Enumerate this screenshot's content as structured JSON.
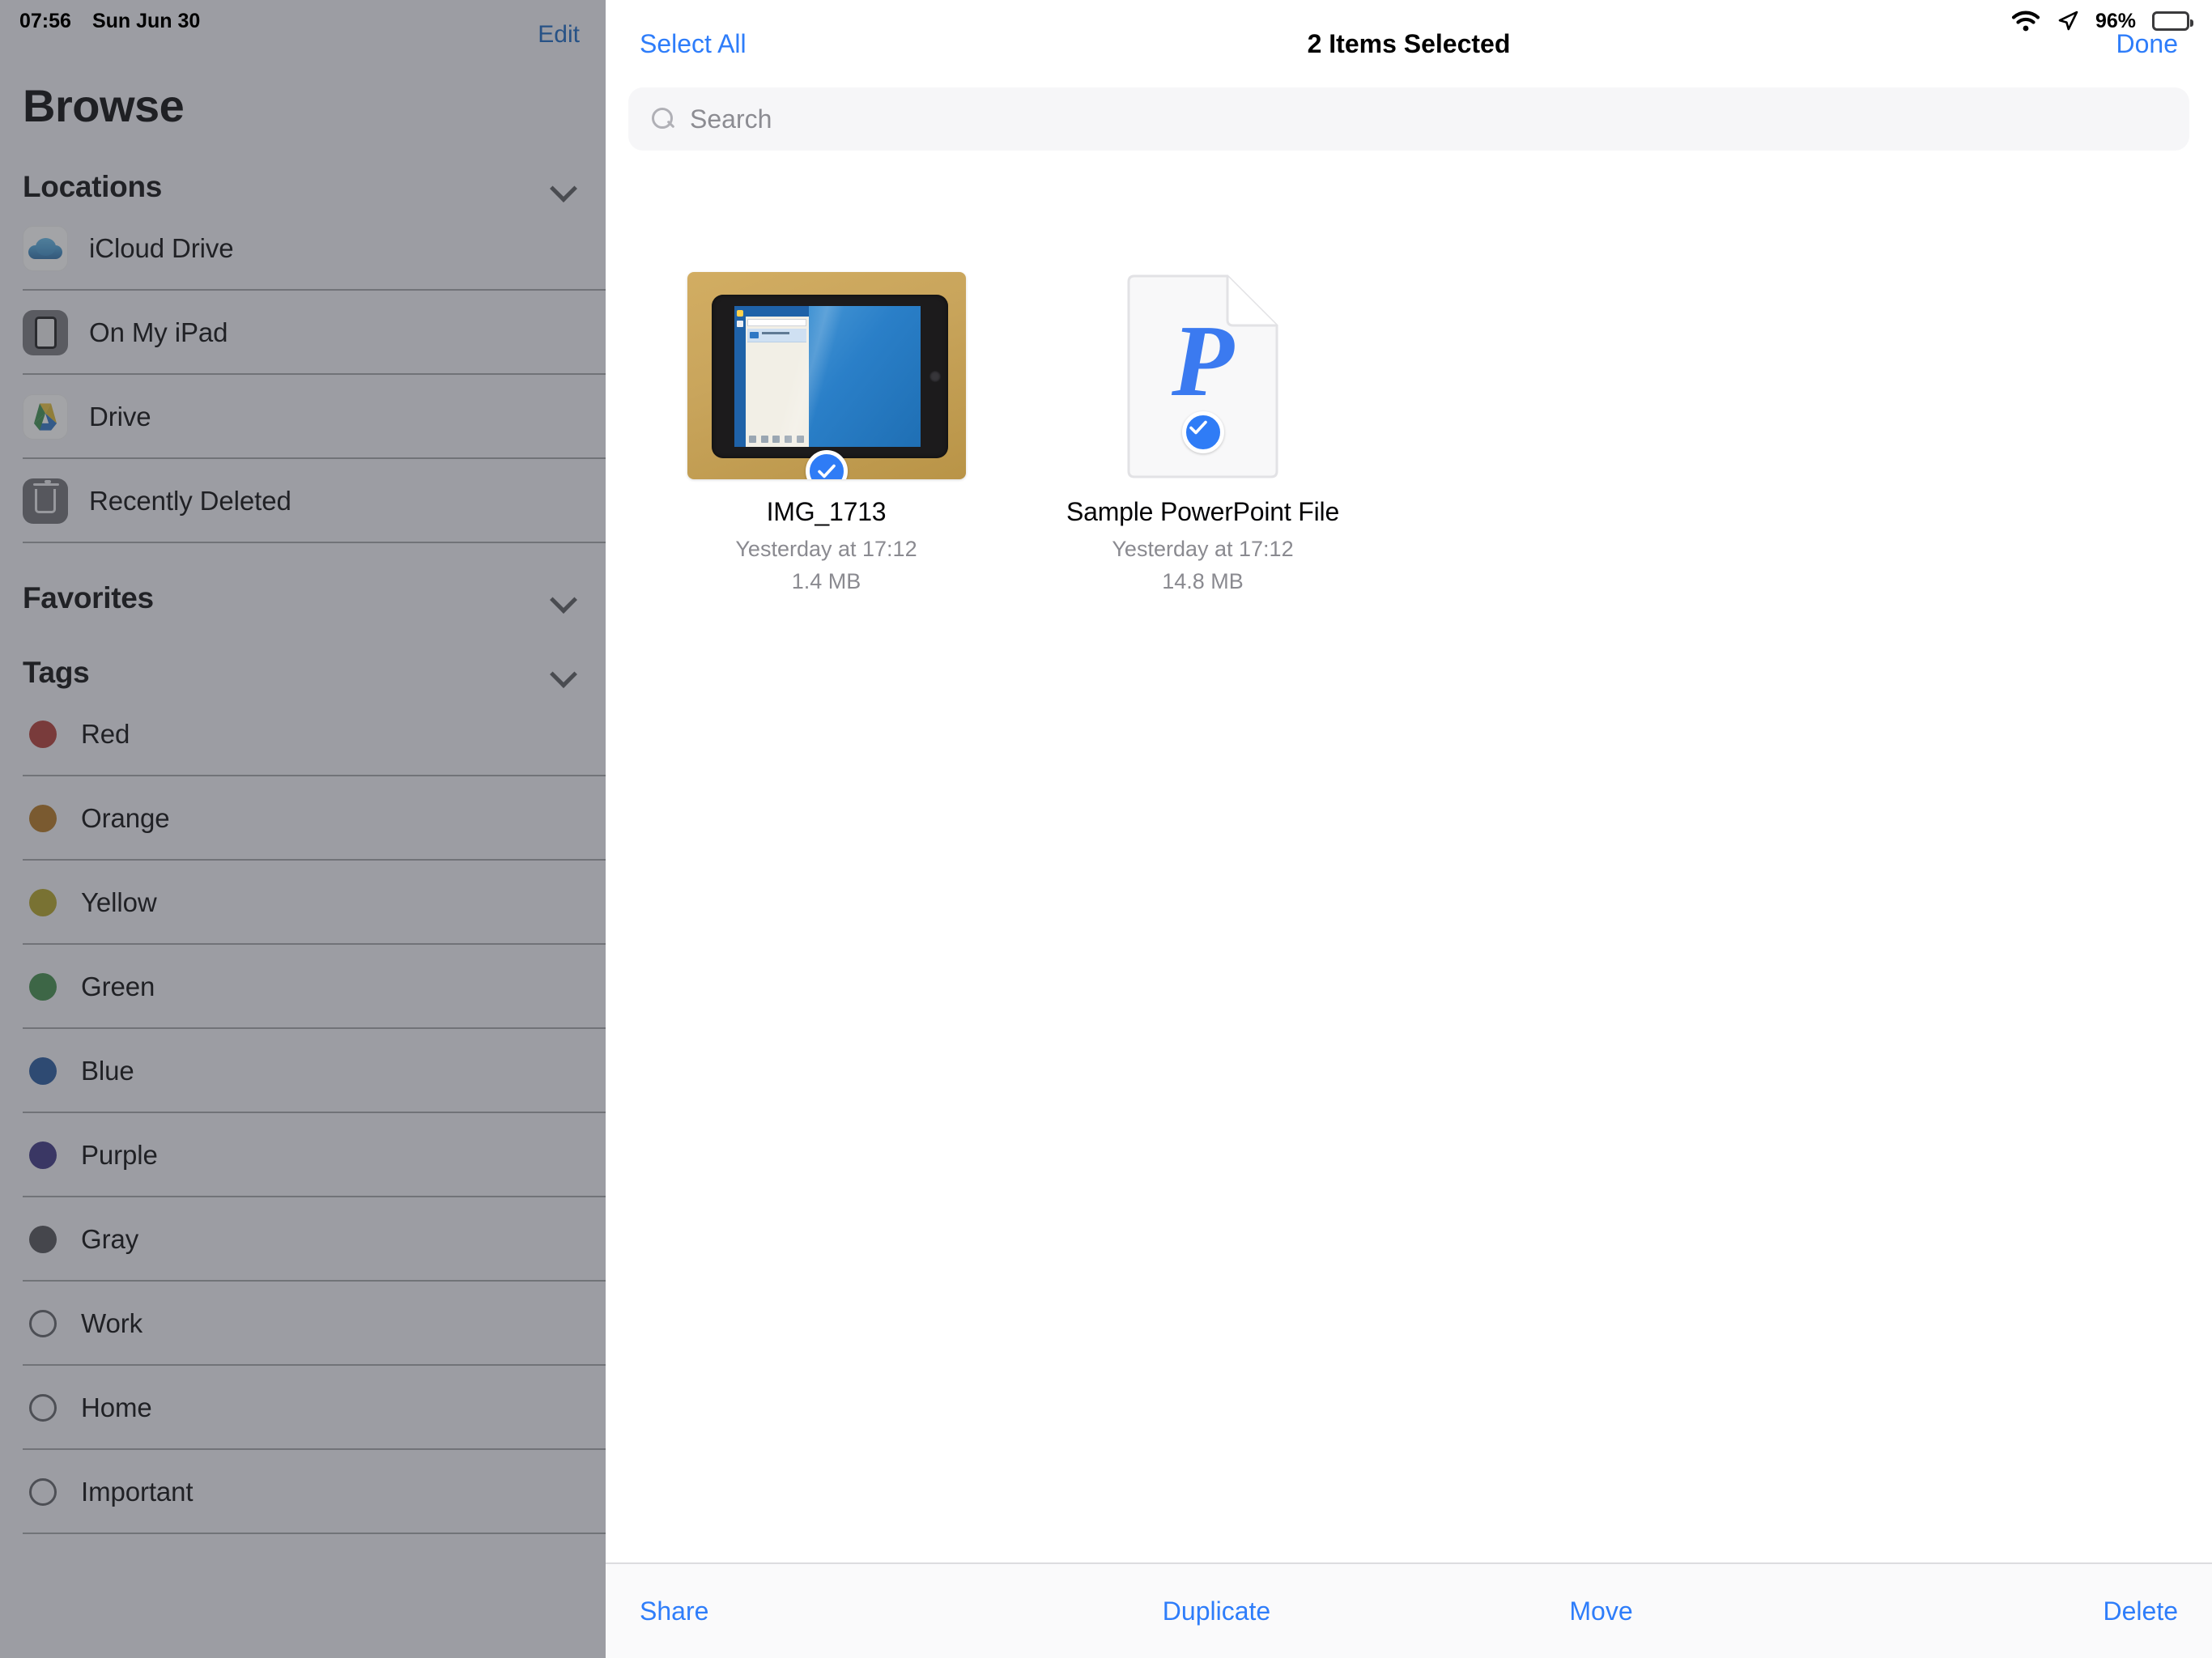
{
  "status_bar": {
    "time": "07:56",
    "date": "Sun Jun 30",
    "battery_percent": "96%",
    "wifi_icon": "wifi-icon",
    "location_icon": "location-arrow-icon",
    "battery_icon": "battery-full-icon"
  },
  "sidebar": {
    "edit_label": "Edit",
    "title": "Browse",
    "sections": [
      {
        "label": "Locations",
        "chevron": "chevron-down-icon",
        "items": [
          {
            "label": "iCloud Drive",
            "icon": "icloud-drive-icon"
          },
          {
            "label": "On My iPad",
            "icon": "ipad-device-icon"
          },
          {
            "label": "Drive",
            "icon": "google-drive-icon"
          },
          {
            "label": "Recently Deleted",
            "icon": "trash-icon"
          }
        ]
      },
      {
        "label": "Favorites",
        "chevron": "chevron-down-icon",
        "items": []
      },
      {
        "label": "Tags",
        "chevron": "chevron-down-icon",
        "items": [
          {
            "label": "Red",
            "icon": "tag-dot-icon",
            "color": "#b03a34"
          },
          {
            "label": "Orange",
            "icon": "tag-dot-icon",
            "color": "#b1741f"
          },
          {
            "label": "Yellow",
            "icon": "tag-dot-icon",
            "color": "#b0a025"
          },
          {
            "label": "Green",
            "icon": "tag-dot-icon",
            "color": "#3f8a48"
          },
          {
            "label": "Blue",
            "icon": "tag-dot-icon",
            "color": "#22559c"
          },
          {
            "label": "Purple",
            "icon": "tag-dot-icon",
            "color": "#3a3180"
          },
          {
            "label": "Gray",
            "icon": "tag-dot-icon",
            "color": "#4e4f53"
          },
          {
            "label": "Work",
            "icon": "tag-dot-outline-icon",
            "color": ""
          },
          {
            "label": "Home",
            "icon": "tag-dot-outline-icon",
            "color": ""
          },
          {
            "label": "Important",
            "icon": "tag-dot-outline-icon",
            "color": ""
          }
        ]
      }
    ]
  },
  "main": {
    "nav": {
      "select_all_label": "Select All",
      "title": "2 Items Selected",
      "done_label": "Done"
    },
    "search": {
      "placeholder": "Search",
      "value": "",
      "icon": "search-icon"
    },
    "files": [
      {
        "name": "IMG_1713",
        "modified": "Yesterday at 17:12",
        "size": "1.4 MB",
        "kind": "photo",
        "selected": true,
        "badge_icon": "checkmark-circle-icon"
      },
      {
        "name": "Sample PowerPoint File",
        "modified": "Yesterday at 17:12",
        "size": "14.8 MB",
        "kind": "powerpoint",
        "glyph": "P",
        "selected": true,
        "badge_icon": "checkmark-circle-icon"
      }
    ],
    "toolbar": [
      {
        "label": "Share"
      },
      {
        "label": "Duplicate"
      },
      {
        "label": "Move"
      },
      {
        "label": "Delete"
      }
    ]
  },
  "colors": {
    "accent_blue": "#2e7dfa",
    "sidebar_bg": "#f2f2f7",
    "sidebar_scrim": "rgba(60,62,68,0.47)",
    "selection_badge": "#2f7cf6",
    "powerpoint_blue": "#3b7af0"
  }
}
